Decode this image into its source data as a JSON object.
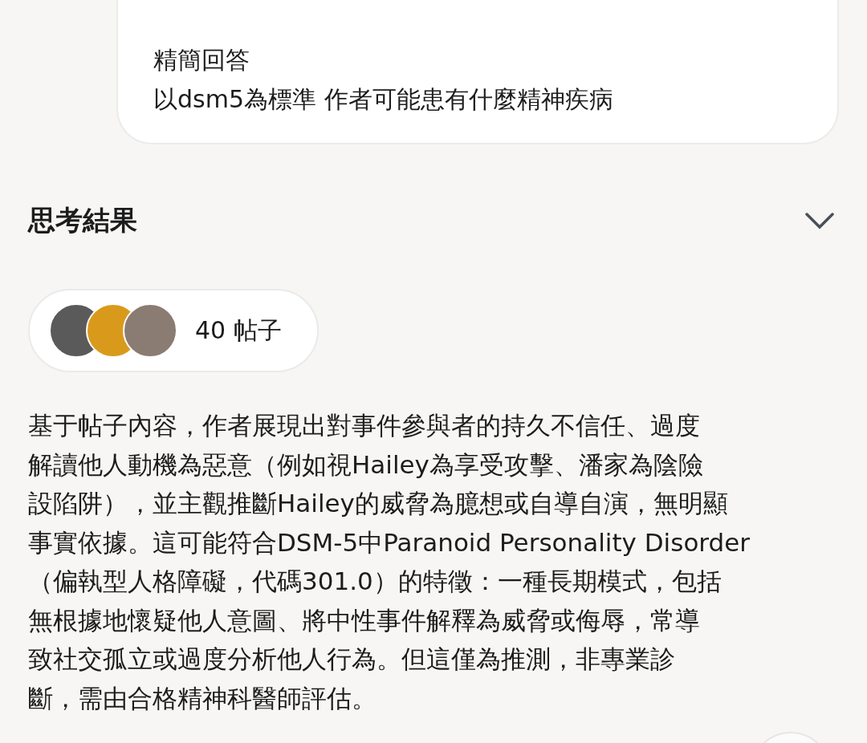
{
  "user_message": {
    "lines": [
      "精簡回答",
      "以dsm5為標準 作者可能患有什麼精神疾病"
    ]
  },
  "thinking_section": {
    "title": "思考結果",
    "expanded": false
  },
  "sources": {
    "label": "40 帖子"
  },
  "answer": {
    "lines": [
      "基于帖子內容，作者展現出對事件參與者的持久不信任、過度",
      "解讀他人動機為惡意（例如視Hailey為享受攻擊、潘家為陰險",
      "設陷阱），並主觀推斷Hailey的威脅為臆想或自導自演，無明顯",
      "事實依據。這可能符合DSM-5中Paranoid Personality Disorder",
      "（偏執型人格障礙，代碼301.0）的特徵：一種長期模式，包括",
      "無根據地懷疑他人意圖、將中性事件解釋為威脅或侮辱，常導",
      "致社交孤立或過度分析他人行為。但這僅為推測，非專業診",
      "斷，需由合格精神科醫師評估。"
    ]
  }
}
